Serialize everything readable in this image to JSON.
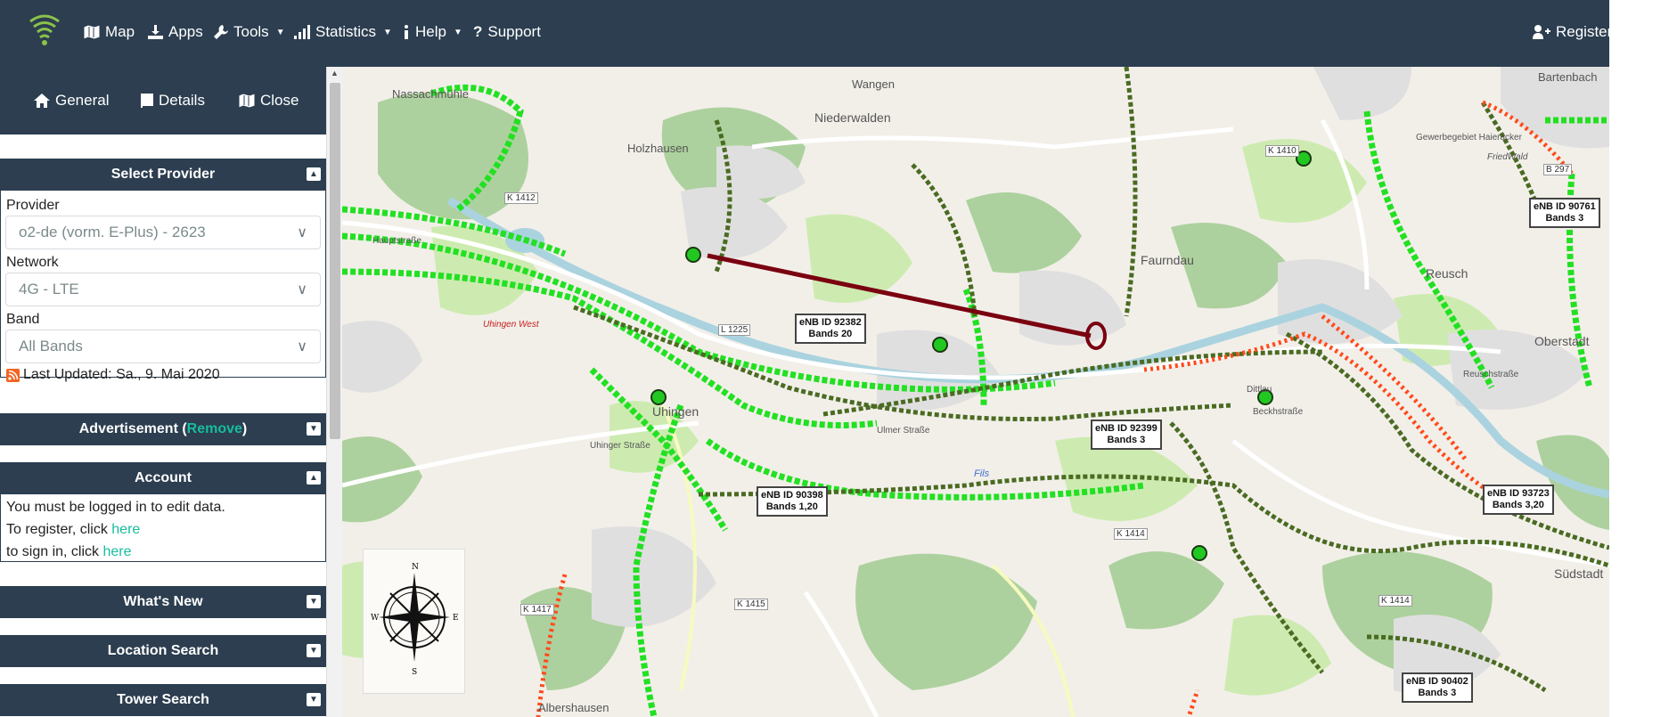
{
  "navbar": {
    "logo_icon": "signal-wifi-icon",
    "items": [
      {
        "label": "Map",
        "icon": "map-icon",
        "dropdown": false
      },
      {
        "label": "Apps",
        "icon": "download-icon",
        "dropdown": false
      },
      {
        "label": "Tools",
        "icon": "wrench-icon",
        "dropdown": true
      },
      {
        "label": "Statistics",
        "icon": "signal-bars-icon",
        "dropdown": true
      },
      {
        "label": "Help",
        "icon": "info-icon",
        "dropdown": true
      },
      {
        "label": "Support",
        "icon": "question-icon",
        "dropdown": false
      }
    ],
    "register": {
      "label": "Register",
      "icon": "user-plus-icon"
    }
  },
  "sidebar": {
    "tabs": [
      {
        "label": "General",
        "icon": "home-icon"
      },
      {
        "label": "Details",
        "icon": "book-icon"
      },
      {
        "label": "Close",
        "icon": "map-icon"
      }
    ],
    "select_provider": {
      "title": "Select Provider",
      "provider_label": "Provider",
      "provider_value": "o2-de (vorm. E-Plus) - 2623",
      "network_label": "Network",
      "network_value": "4G - LTE",
      "band_label": "Band",
      "band_value": "All Bands",
      "last_updated": "Last Updated: Sa., 9. Mai 2020"
    },
    "advertisement": {
      "title_prefix": "Advertisement (",
      "remove_label": "Remove",
      "title_suffix": ")"
    },
    "account": {
      "title": "Account",
      "line1": "You must be logged in to edit data.",
      "line2_prefix": "To register, click ",
      "line2_link": "here",
      "line3_prefix": "to sign in, click ",
      "line3_link": "here"
    },
    "whats_new": {
      "title": "What's New"
    },
    "location_search": {
      "title": "Location Search"
    },
    "tower_search": {
      "title": "Tower Search"
    }
  },
  "map": {
    "place_names": [
      "Wangen",
      "Niederwalden",
      "Nassachmühle",
      "Holzhausen",
      "Bartenbach",
      "Reusch",
      "Oberstadt",
      "Uhingen",
      "Südstadt",
      "Albershausen",
      "Faurndau",
      "Gewerbegebiet Haieracker",
      "FriedWald",
      "Dittlau"
    ],
    "road_labels": [
      "K 1410",
      "B 297",
      "L 1225",
      "K 1414",
      "K 1415",
      "K 1417",
      "K 1412",
      "K 1414"
    ],
    "street_labels": [
      "Hauptstraße",
      "Uhinger Straße",
      "Ulmer Straße",
      "Beckhstraße",
      "Uhingen West",
      "Reuschstraße",
      "Fils"
    ],
    "towers": [
      {
        "id": "eNB ID 92382",
        "bands": "Bands 20"
      },
      {
        "id": "eNB ID 92399",
        "bands": "Bands 3"
      },
      {
        "id": "eNB ID 90398",
        "bands": "Bands 1,20"
      },
      {
        "id": "eNB ID 90761",
        "bands": "Bands 3"
      },
      {
        "id": "eNB ID 93723",
        "bands": "Bands 3,20"
      },
      {
        "id": "eNB ID 90402",
        "bands": "Bands 3"
      }
    ],
    "compass_icon": "compass-rose-icon",
    "colors": {
      "signal_strong": "#22e022",
      "signal_dark": "#4a6b22",
      "signal_weak": "#ff4a1a",
      "link_line": "#7a0010",
      "navbar": "#2c3e50",
      "accent": "#18bc9c"
    }
  }
}
